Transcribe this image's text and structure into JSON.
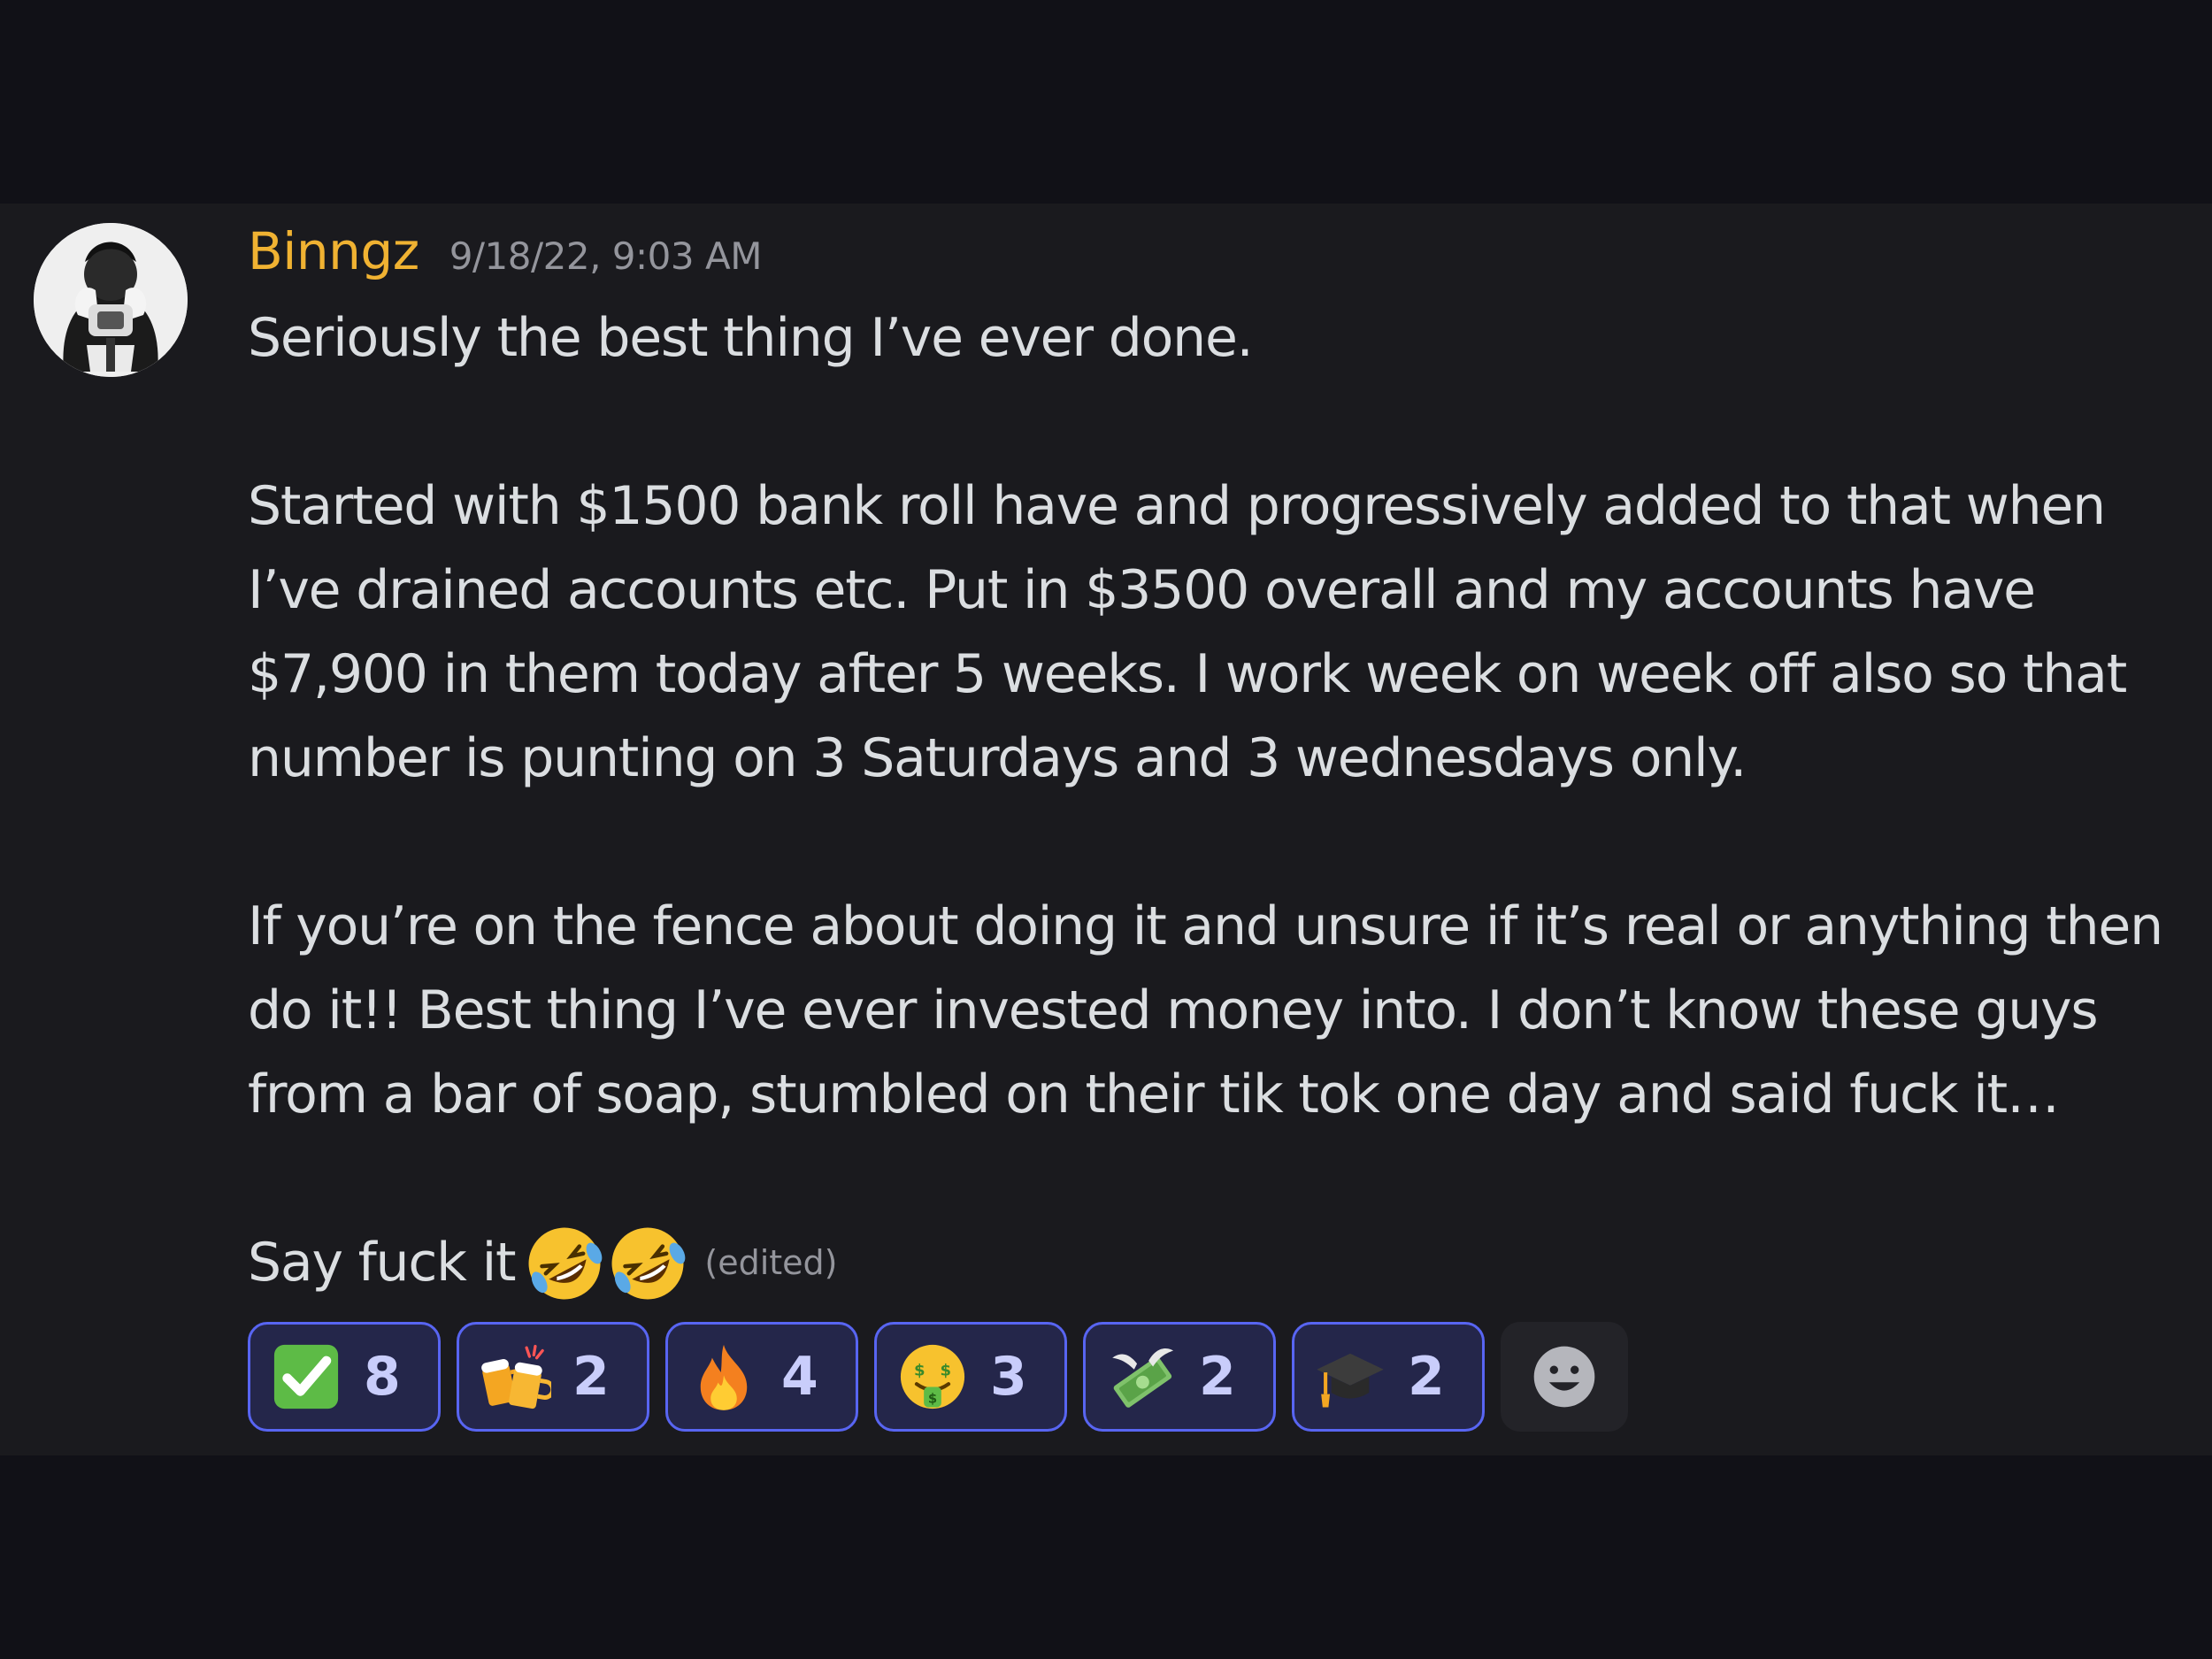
{
  "message": {
    "username": "Binngz",
    "timestamp": "9/18/22, 9:03 AM",
    "paragraphs": {
      "p1": [
        "Seriously the best thing I’ve ever done."
      ],
      "p2": [
        "Started with $1500 bank roll have and progressively added to that when",
        "I’ve drained accounts etc. Put in $3500 overall and my accounts have",
        "$7,900 in them today after 5 weeks. I work week on week off also so that",
        "number is punting on 3 Saturdays and 3 wednesdays only."
      ],
      "p3": [
        "If you’re on the fence about doing it and unsure if it’s real or anything then",
        "do it!!  Best thing I’ve ever invested money into. I don’t know these guys",
        "from a bar of soap, stumbled on their tik tok one day and said fuck it…"
      ],
      "p4": "Say fuck it"
    },
    "inline_emojis": [
      "rolling-on-floor-laughing",
      "rolling-on-floor-laughing"
    ],
    "edited_label": "(edited)"
  },
  "reactions": [
    {
      "emoji": "check-mark-button",
      "count": "8"
    },
    {
      "emoji": "clinking-beer-mugs",
      "count": "2"
    },
    {
      "emoji": "fire",
      "count": "4"
    },
    {
      "emoji": "money-mouth-face",
      "count": "3"
    },
    {
      "emoji": "money-with-wings",
      "count": "2"
    },
    {
      "emoji": "graduation-cap",
      "count": "2"
    }
  ],
  "add_reaction_icon": "smiley-icon",
  "colors": {
    "background": "#111117",
    "message_background": "#1a1a1e",
    "username": "#f0b232",
    "text": "#dbdee1",
    "muted": "#94959c",
    "reaction_border": "#5865f2",
    "reaction_bg": "#24264a"
  }
}
